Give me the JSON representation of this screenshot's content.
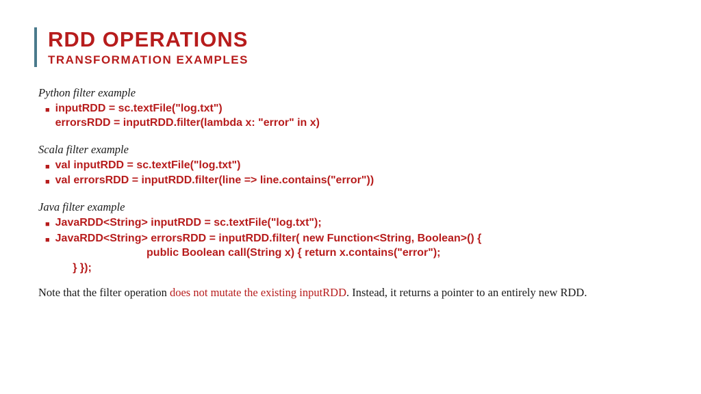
{
  "title": "RDD OPERATIONS",
  "subtitle": "TRANSFORMATION EXAMPLES",
  "sections": {
    "python": {
      "label": "Python filter example",
      "line1": "inputRDD = sc.textFile(\"log.txt\")",
      "line2": "errorsRDD = inputRDD.filter(lambda x: \"error\" in x)"
    },
    "scala": {
      "label": "Scala filter example",
      "line1": "val inputRDD = sc.textFile(\"log.txt\")",
      "line2": "val errorsRDD = inputRDD.filter(line => line.contains(\"error\"))"
    },
    "java": {
      "label": "Java filter example",
      "line1": "JavaRDD<String> inputRDD = sc.textFile(\"log.txt\");",
      "line2": "JavaRDD<String> errorsRDD = inputRDD.filter( new Function<String, Boolean>() {",
      "line3": "                              public Boolean call(String x) { return x.contains(\"error\");",
      "line4": "     } });"
    }
  },
  "note": {
    "pre": "Note that the filter operation ",
    "highlight": "does not mutate the existing inputRDD",
    "post": ". Instead, it returns a pointer to an entirely new RDD."
  }
}
